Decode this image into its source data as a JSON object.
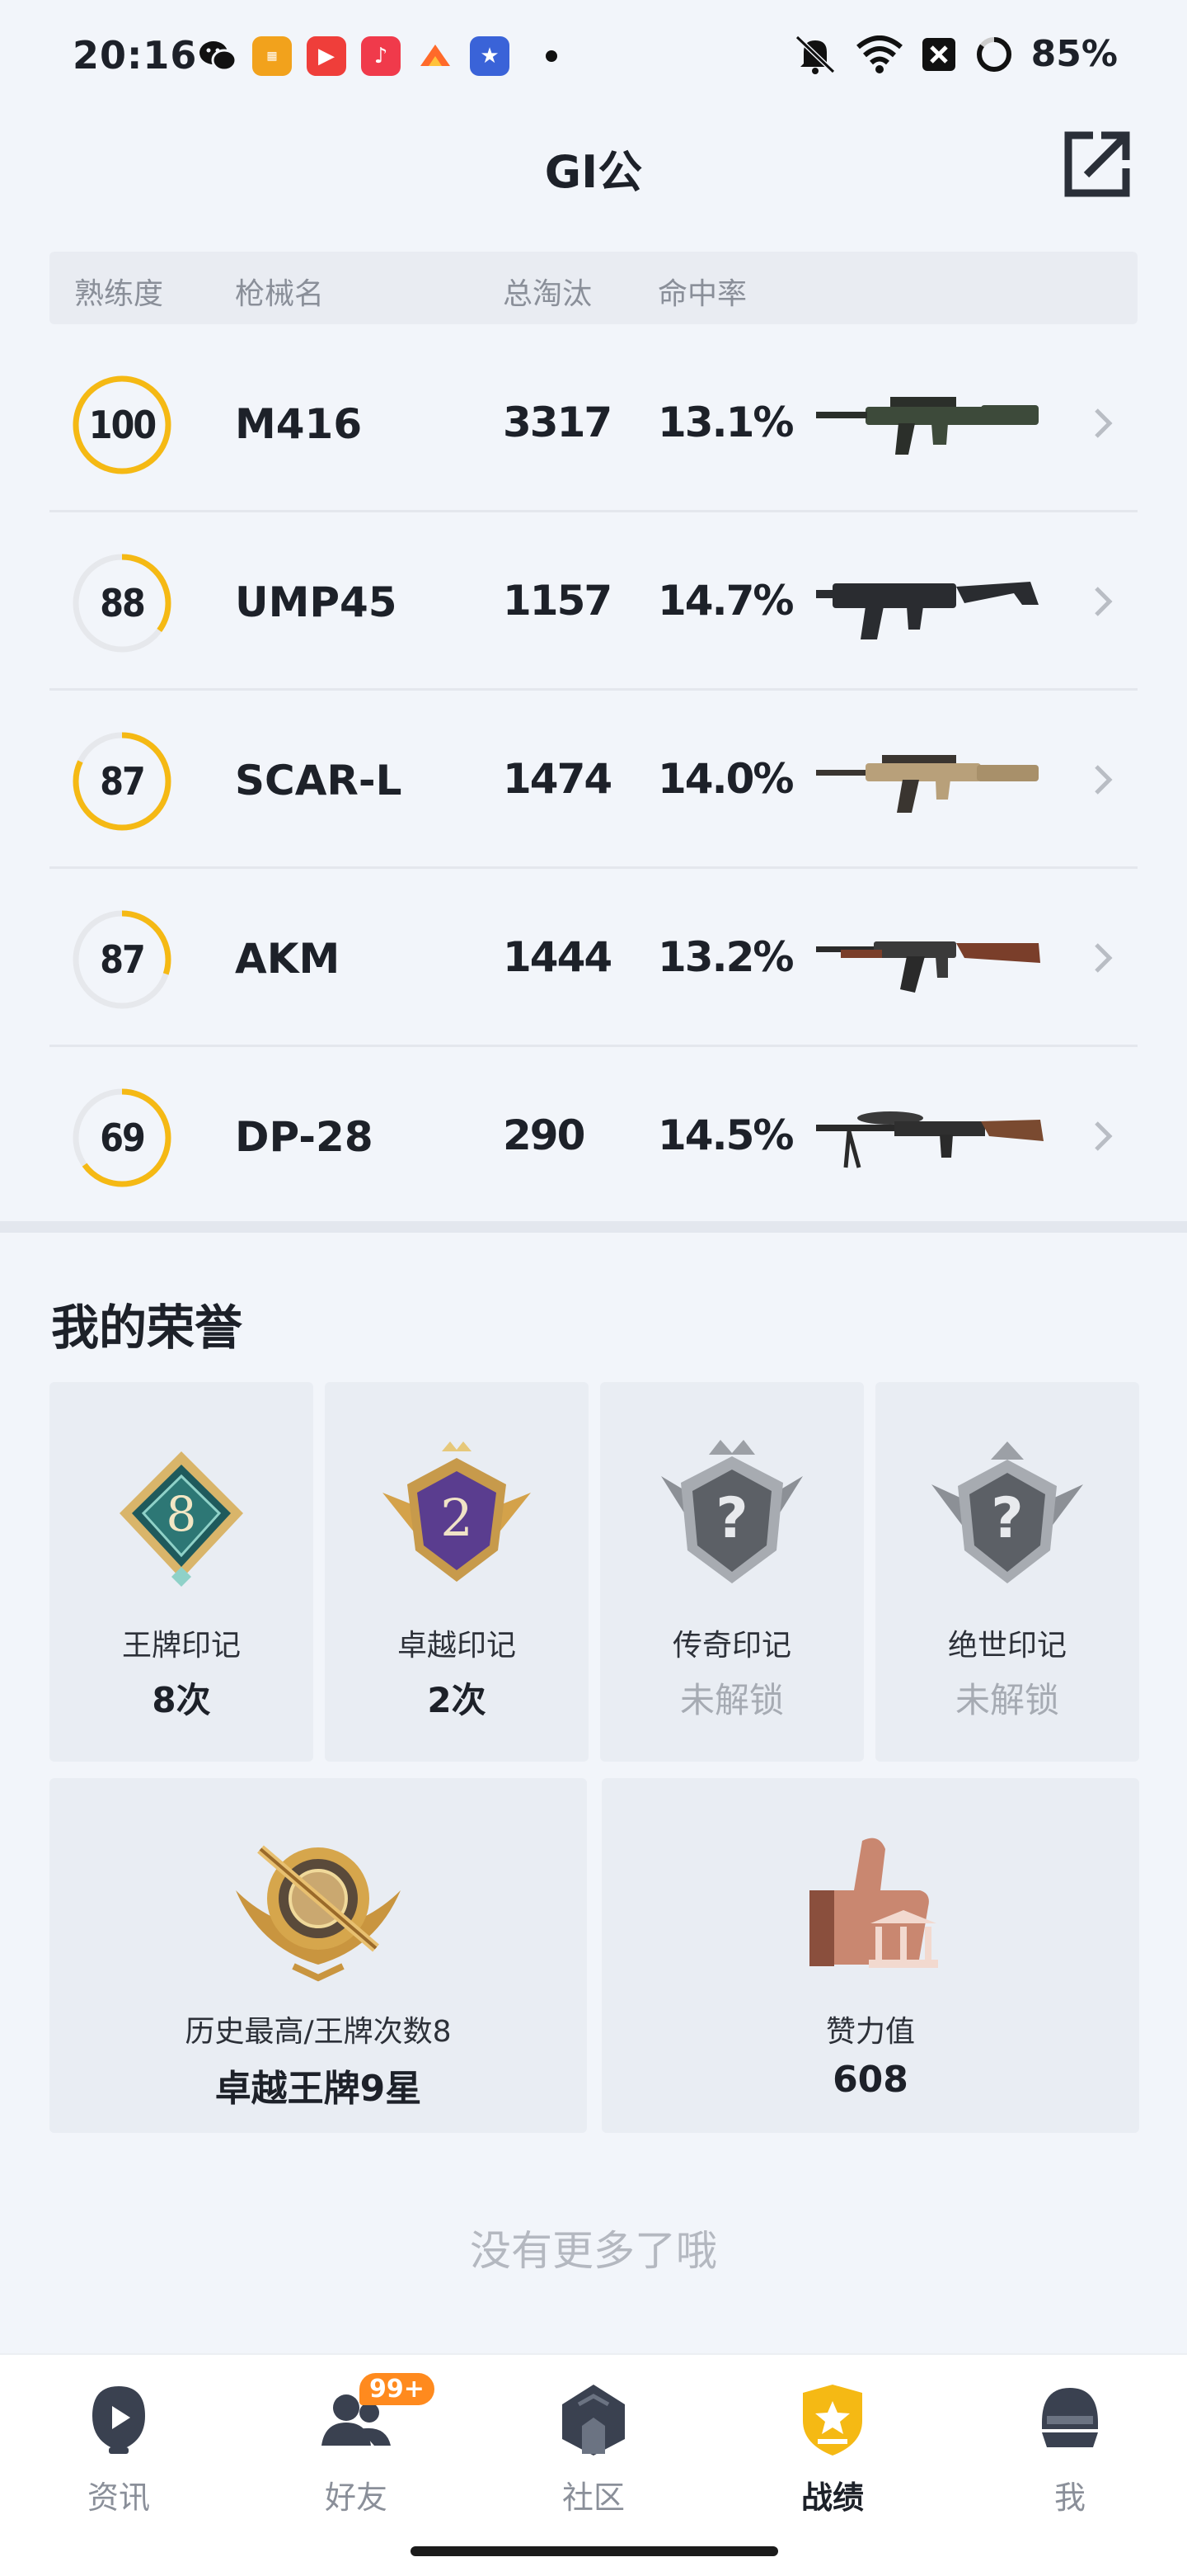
{
  "status_bar": {
    "time": "20:16",
    "battery": "85%",
    "app_icons": [
      "wechat-icon",
      "news-app-icon",
      "video-app-icon",
      "music-app-icon",
      "game-app-icon",
      "anime-game-icon"
    ]
  },
  "header": {
    "title": "GI公",
    "share_icon": "share-external-icon"
  },
  "table": {
    "headers": {
      "mastery": "熟练度",
      "name": "枪械名",
      "kills": "总淘汰",
      "accuracy": "命中率"
    },
    "rows": [
      {
        "mastery": "100",
        "mastery_pct": 100,
        "name": "M416",
        "kills": "3317",
        "accuracy": "13.1%",
        "gun": "assault-rifle"
      },
      {
        "mastery": "88",
        "mastery_pct": 35,
        "name": "UMP45",
        "kills": "1157",
        "accuracy": "14.7%",
        "gun": "smg"
      },
      {
        "mastery": "87",
        "mastery_pct": 82,
        "name": "SCAR-L",
        "kills": "1474",
        "accuracy": "14.0%",
        "gun": "assault-rifle-tan"
      },
      {
        "mastery": "87",
        "mastery_pct": 30,
        "name": "AKM",
        "kills": "1444",
        "accuracy": "13.2%",
        "gun": "akm"
      },
      {
        "mastery": "69",
        "mastery_pct": 65,
        "name": "DP-28",
        "kills": "290",
        "accuracy": "14.5%",
        "gun": "lmg"
      }
    ]
  },
  "honors": {
    "title": "我的荣誉",
    "badges": [
      {
        "label": "王牌印记",
        "value": "8次",
        "locked": false,
        "emblem": "8"
      },
      {
        "label": "卓越印记",
        "value": "2次",
        "locked": false,
        "emblem": "2"
      },
      {
        "label": "传奇印记",
        "value": "未解锁",
        "locked": true,
        "emblem": "?"
      },
      {
        "label": "绝世印记",
        "value": "未解锁",
        "locked": true,
        "emblem": "?"
      }
    ],
    "highest": {
      "label": "历史最高/王牌次数8",
      "value": "卓越王牌9星"
    },
    "likes": {
      "label": "赞力值",
      "value": "608"
    }
  },
  "footer_note": "没有更多了哦",
  "tabs": [
    {
      "label": "资讯",
      "icon": "news-icon",
      "active": false
    },
    {
      "label": "好友",
      "icon": "friends-icon",
      "active": false,
      "badge": "99+"
    },
    {
      "label": "社区",
      "icon": "community-icon",
      "active": false
    },
    {
      "label": "战绩",
      "icon": "record-icon",
      "active": true
    },
    {
      "label": "我",
      "icon": "profile-icon",
      "active": false
    }
  ],
  "colors": {
    "accent": "#f5b914",
    "background": "#f2f5fa",
    "badge_orange": "#ff8a1e"
  }
}
